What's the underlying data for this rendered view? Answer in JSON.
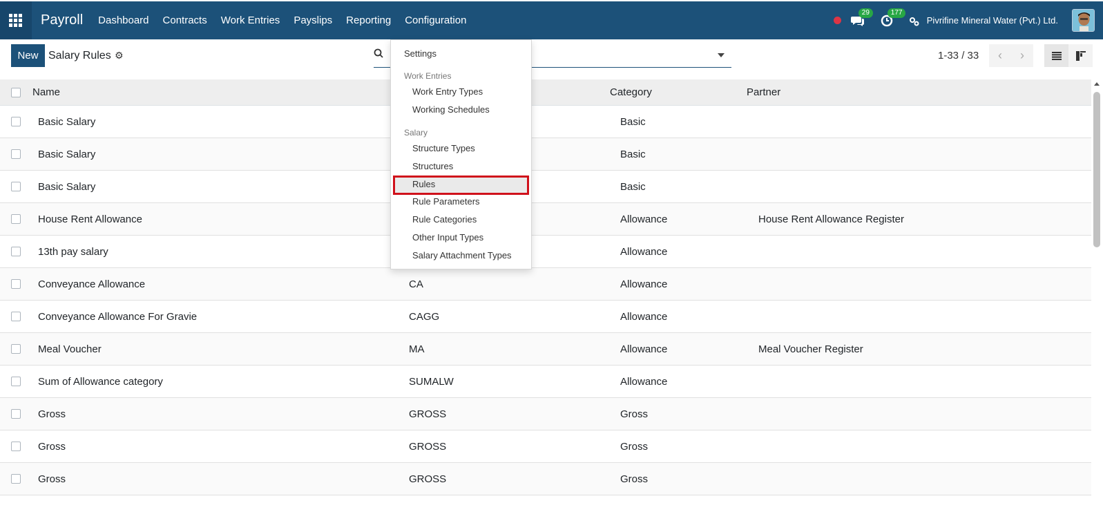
{
  "navbar": {
    "brand": "Payroll",
    "menu": [
      "Dashboard",
      "Contracts",
      "Work Entries",
      "Payslips",
      "Reporting",
      "Configuration"
    ],
    "chat_badge": "29",
    "activity_badge": "177",
    "company": "Pivrifine Mineral Water (Pvt.) Ltd."
  },
  "control_panel": {
    "new_label": "New",
    "title": "Salary Rules",
    "pager": "1-33 / 33"
  },
  "table": {
    "headers": {
      "name": "Name",
      "category": "Category",
      "partner": "Partner"
    },
    "rows": [
      {
        "name": "Basic Salary",
        "code": "",
        "category": "Basic",
        "partner": ""
      },
      {
        "name": "Basic Salary",
        "code": "",
        "category": "Basic",
        "partner": ""
      },
      {
        "name": "Basic Salary",
        "code": "",
        "category": "Basic",
        "partner": ""
      },
      {
        "name": "House Rent Allowance",
        "code": "",
        "category": "Allowance",
        "partner": "House Rent Allowance Register"
      },
      {
        "name": "13th pay salary",
        "code": "",
        "category": "Allowance",
        "partner": ""
      },
      {
        "name": "Conveyance Allowance",
        "code": "CA",
        "category": "Allowance",
        "partner": ""
      },
      {
        "name": "Conveyance Allowance For Gravie",
        "code": "CAGG",
        "category": "Allowance",
        "partner": ""
      },
      {
        "name": "Meal Voucher",
        "code": "MA",
        "category": "Allowance",
        "partner": "Meal Voucher Register"
      },
      {
        "name": "Sum of Allowance category",
        "code": "SUMALW",
        "category": "Allowance",
        "partner": ""
      },
      {
        "name": "Gross",
        "code": "GROSS",
        "category": "Gross",
        "partner": ""
      },
      {
        "name": "Gross",
        "code": "GROSS",
        "category": "Gross",
        "partner": ""
      },
      {
        "name": "Gross",
        "code": "GROSS",
        "category": "Gross",
        "partner": ""
      }
    ]
  },
  "dropdown": {
    "settings": "Settings",
    "work_entries_header": "Work Entries",
    "work_entry_types": "Work Entry Types",
    "working_schedules": "Working Schedules",
    "salary_header": "Salary",
    "structure_types": "Structure Types",
    "structures": "Structures",
    "rules": "Rules",
    "rule_parameters": "Rule Parameters",
    "rule_categories": "Rule Categories",
    "other_input_types": "Other Input Types",
    "salary_attachment_types": "Salary Attachment Types"
  }
}
